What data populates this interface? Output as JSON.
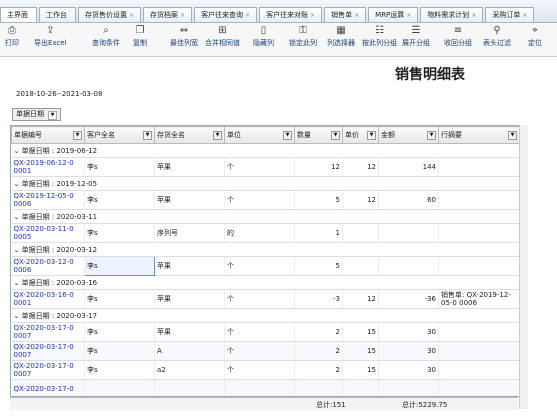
{
  "tabs": [
    {
      "label": "主界面",
      "close": ""
    },
    {
      "label": "工作台",
      "close": ""
    },
    {
      "label": "存货售价设置",
      "close": "×"
    },
    {
      "label": "存货档案",
      "close": "×"
    },
    {
      "label": "客户往来查询",
      "close": "×"
    },
    {
      "label": "客户往来对账",
      "close": "×"
    },
    {
      "label": "销售单",
      "close": "×"
    },
    {
      "label": "MRP运算",
      "close": "×"
    },
    {
      "label": "物料需求计划",
      "close": "×"
    },
    {
      "label": "采购订单",
      "close": "×"
    }
  ],
  "toolbar": [
    {
      "label": "打印",
      "icon": "printer-icon"
    },
    {
      "label": "导出Excel",
      "icon": "export-icon"
    },
    {
      "label": "查询条件",
      "icon": "search-icon"
    },
    {
      "label": "复制",
      "icon": "copy-icon"
    },
    {
      "label": "最佳列宽",
      "icon": "best-fit-icon"
    },
    {
      "label": "合并相同值",
      "icon": "merge-icon"
    },
    {
      "label": "隐藏列",
      "icon": "hide-column-icon"
    },
    {
      "label": "锁定此列",
      "icon": "lock-icon"
    },
    {
      "label": "列选择器",
      "icon": "column-chooser-icon"
    },
    {
      "label": "按此列分组",
      "icon": "group-icon"
    },
    {
      "label": "展开分组",
      "icon": "expand-icon"
    },
    {
      "label": "收回分组",
      "icon": "collapse-icon"
    },
    {
      "label": "表头过滤",
      "icon": "filter-icon"
    },
    {
      "label": "定位",
      "icon": "locate-icon"
    }
  ],
  "report": {
    "title": "销售明细表",
    "date_range": "2018-10-26--2021-03-08"
  },
  "group_by": {
    "label": "单据日期"
  },
  "columns": [
    "单据编号",
    "客户全名",
    "存货全名",
    "单位",
    "数量",
    "单价",
    "金额",
    "行摘要"
  ],
  "groups": [
    {
      "label": "单据日期 : 2019-06-12",
      "rows": [
        {
          "code": "QX-2019-06-12-0 0001",
          "customer": "李s",
          "item": "苹果",
          "unit": "个",
          "qty": "12",
          "price": "12",
          "amount": "144",
          "memo": ""
        }
      ]
    },
    {
      "label": "单据日期 : 2019-12-05",
      "rows": [
        {
          "code": "QX-2019-12-05-0 0006",
          "customer": "李s",
          "item": "苹果",
          "unit": "个",
          "qty": "5",
          "price": "12",
          "amount": "60",
          "memo": ""
        }
      ]
    },
    {
      "label": "单据日期 : 2020-03-11",
      "rows": [
        {
          "code": "QX-2020-03-11-0 0005",
          "customer": "李s",
          "item": "序列号",
          "unit": "的",
          "qty": "1",
          "price": "",
          "amount": "",
          "memo": ""
        }
      ]
    },
    {
      "label": "单据日期 : 2020-03-12",
      "rows": [
        {
          "code": "QX-2020-03-12-0 0006",
          "customer": "李s",
          "item": "苹果",
          "unit": "个",
          "qty": "5",
          "price": "",
          "amount": "",
          "memo": ""
        }
      ]
    },
    {
      "label": "单据日期 : 2020-03-16",
      "rows": [
        {
          "code": "QX-2020-03-16-0 0001",
          "customer": "李s",
          "item": "苹果",
          "unit": "个",
          "qty": "-3",
          "price": "12",
          "amount": "-36",
          "memo": "销售单: QX-2019-12-05-0 0006"
        }
      ]
    },
    {
      "label": "单据日期 : 2020-03-17",
      "rows": [
        {
          "code": "QX-2020-03-17-0 0007",
          "customer": "李s",
          "item": "苹果",
          "unit": "个",
          "qty": "2",
          "price": "15",
          "amount": "30",
          "memo": ""
        },
        {
          "code": "QX-2020-03-17-0 0007",
          "customer": "李s",
          "item": "A",
          "unit": "个",
          "qty": "2",
          "price": "15",
          "amount": "30",
          "memo": ""
        },
        {
          "code": "QX-2020-03-17-0 0007",
          "customer": "李s",
          "item": "a2",
          "unit": "个",
          "qty": "2",
          "price": "15",
          "amount": "30",
          "memo": ""
        },
        {
          "code": "QX-2020-03-17-0",
          "customer": "",
          "item": "",
          "unit": "",
          "qty": "",
          "price": "",
          "amount": "",
          "memo": ""
        }
      ]
    }
  ],
  "footer": {
    "qty_total": "总计:151",
    "amount_total": "总计:5229.75"
  }
}
